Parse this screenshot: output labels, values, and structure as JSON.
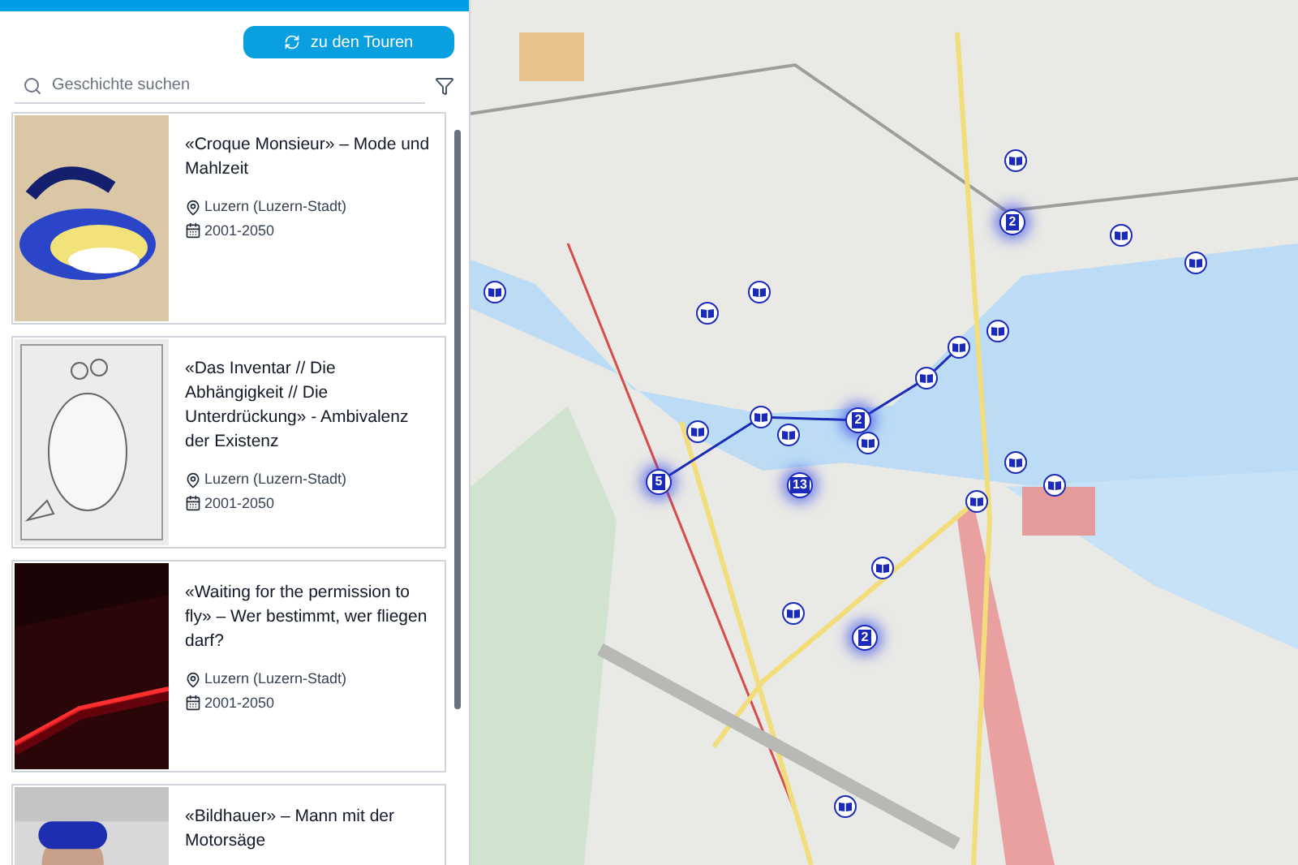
{
  "tours_button": {
    "label": "zu den Touren"
  },
  "search": {
    "placeholder": "Geschichte suchen"
  },
  "stories": [
    {
      "title": "«Croque Monsieur» – Mode und Mahlzeit",
      "place": "Luzern (Luzern-Stadt)",
      "period": "2001-2050"
    },
    {
      "title": "«Das Inventar // Die Abhängigkeit // Die Unterdrückung» -   Ambivalenz der Existenz",
      "place": "Luzern (Luzern-Stadt)",
      "period": "2001-2050"
    },
    {
      "title": "«Waiting for the permission to fly» – Wer bestimmt, wer fliegen darf?",
      "place": "Luzern (Luzern-Stadt)",
      "period": "2001-2050"
    },
    {
      "title": "«Bildhauer» – Mann mit der Motorsäge"
    }
  ],
  "map": {
    "markers": [
      {
        "kind": "story"
      },
      {
        "kind": "cluster",
        "count": "2"
      },
      {
        "kind": "story"
      },
      {
        "kind": "story"
      },
      {
        "kind": "story"
      },
      {
        "kind": "story"
      },
      {
        "kind": "story"
      },
      {
        "kind": "story"
      },
      {
        "kind": "story"
      },
      {
        "kind": "story"
      },
      {
        "kind": "story"
      },
      {
        "kind": "cluster",
        "count": "2"
      },
      {
        "kind": "story"
      },
      {
        "kind": "story"
      },
      {
        "kind": "story"
      },
      {
        "kind": "cluster",
        "count": "5"
      },
      {
        "kind": "cluster",
        "count": "13"
      },
      {
        "kind": "story"
      },
      {
        "kind": "story"
      },
      {
        "kind": "story"
      },
      {
        "kind": "story"
      },
      {
        "kind": "story"
      },
      {
        "kind": "cluster",
        "count": "2"
      },
      {
        "kind": "story"
      }
    ]
  }
}
